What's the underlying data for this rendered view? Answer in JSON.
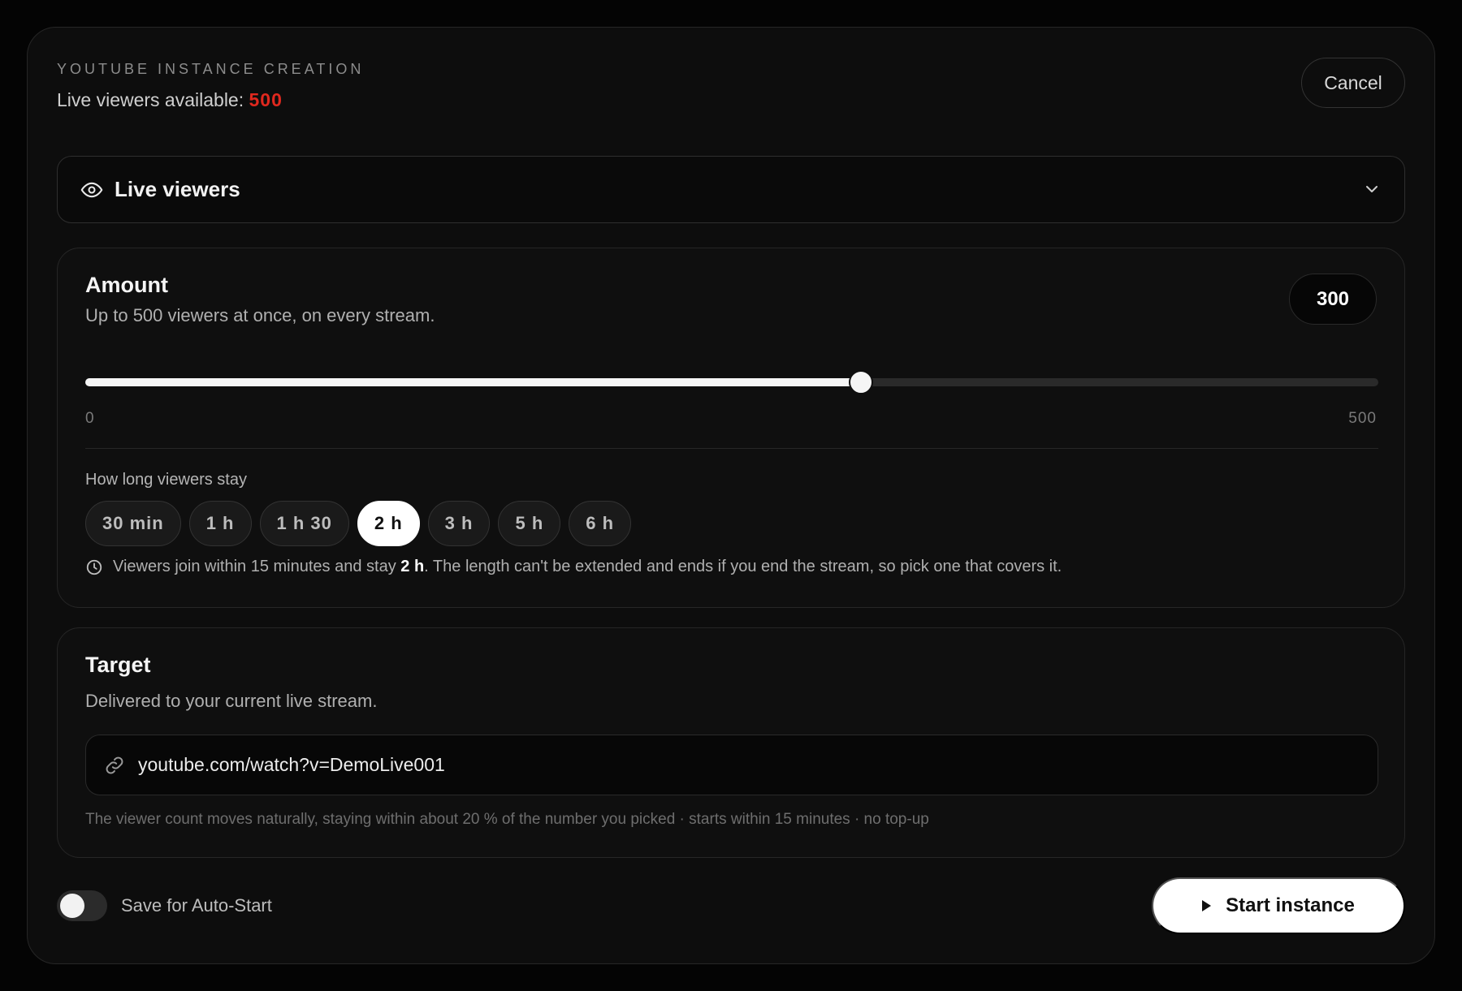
{
  "header": {
    "eyebrow": "YOUTUBE INSTANCE CREATION",
    "available_label": "Live viewers available:",
    "available_value": "500",
    "available_color": "#e0281e",
    "cancel_label": "Cancel"
  },
  "service_select": {
    "icon": "eye-icon",
    "label": "Live viewers",
    "chevron": "chevron-down-icon"
  },
  "amount": {
    "title": "Amount",
    "subtitle": "Up to 500 viewers at once, on every stream.",
    "value": "300",
    "min": 0,
    "max": 500,
    "fraction": 0.6,
    "min_label": "0",
    "max_label": "500"
  },
  "duration": {
    "label": "How long viewers stay",
    "options": [
      "30 min",
      "1 h",
      "1 h 30",
      "2 h",
      "3 h",
      "5 h",
      "6 h"
    ],
    "selected": "2 h",
    "info_icon": "clock-icon",
    "info_pre": "Viewers join within 15 minutes and stay",
    "info_bold": "2 h",
    "info_post": ". The length can't be extended and ends if you end the stream, so pick one that covers it."
  },
  "target": {
    "title": "Target",
    "subtitle": "Delivered to your current live stream.",
    "link_icon": "link-icon",
    "url": "youtube.com/watch?v=DemoLive001",
    "note": "The viewer count moves naturally, staying within about 20 % of the number you picked · starts within 15 minutes · no top-up"
  },
  "footer": {
    "autostart_label": "Save for Auto-Start",
    "autostart_on": false,
    "start_label": "Start instance",
    "start_icon": "play-icon"
  }
}
